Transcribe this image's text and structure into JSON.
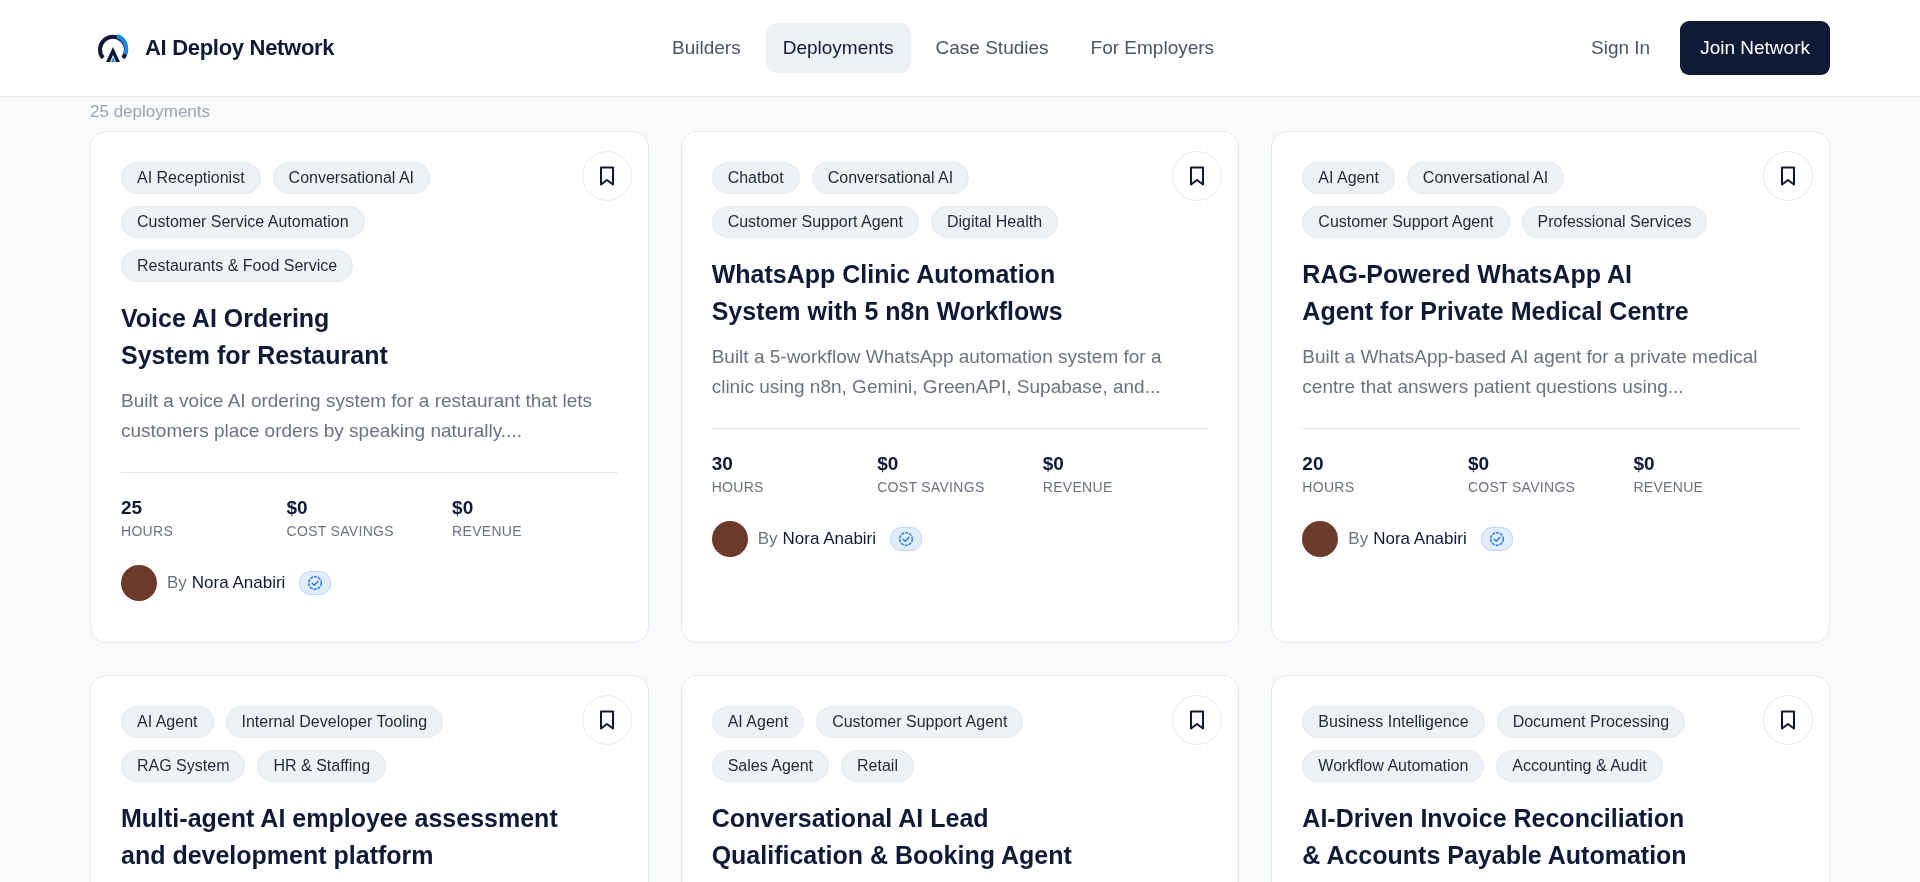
{
  "header": {
    "brand": "AI Deploy Network",
    "nav": [
      {
        "label": "Builders",
        "selected": false
      },
      {
        "label": "Deployments",
        "selected": true
      },
      {
        "label": "Case Studies",
        "selected": false
      },
      {
        "label": "For Employers",
        "selected": false
      }
    ],
    "sign_in": "Sign In",
    "join_button": "Join Network"
  },
  "results_count": "25 deployments",
  "cards": [
    {
      "tags": [
        "AI Receptionist",
        "Conversational AI",
        "Customer Service Automation",
        "Restaurants & Food Service"
      ],
      "title": "Voice AI Ordering System for Restaurant",
      "description": "Built a voice AI ordering system for a restaurant that lets customers place orders by speaking naturally....",
      "stats": [
        {
          "value": "25",
          "label": "HOURS"
        },
        {
          "value": "$0",
          "label": "COST SAVINGS"
        },
        {
          "value": "$0",
          "label": "REVENUE"
        }
      ],
      "author_prefix": "By",
      "author": "Nora Anabiri",
      "verified": true,
      "bookmarked": false
    },
    {
      "tags": [
        "Chatbot",
        "Conversational AI",
        "Customer Support Agent",
        "Digital Health"
      ],
      "title": "WhatsApp Clinic Automation System with 5 n8n Workflows",
      "description": "Built a 5-workflow WhatsApp automation system for a clinic using n8n, Gemini, GreenAPI, Supabase, and...",
      "stats": [
        {
          "value": "30",
          "label": "HOURS"
        },
        {
          "value": "$0",
          "label": "COST SAVINGS"
        },
        {
          "value": "$0",
          "label": "REVENUE"
        }
      ],
      "author_prefix": "By",
      "author": "Nora Anabiri",
      "verified": true,
      "bookmarked": false
    },
    {
      "tags": [
        "AI Agent",
        "Conversational AI",
        "Customer Support Agent",
        "Professional Services"
      ],
      "title": "RAG-Powered WhatsApp AI Agent for Private Medical Centre",
      "description": "Built a WhatsApp-based AI agent for a private medical centre that answers patient questions using...",
      "stats": [
        {
          "value": "20",
          "label": "HOURS"
        },
        {
          "value": "$0",
          "label": "COST SAVINGS"
        },
        {
          "value": "$0",
          "label": "REVENUE"
        }
      ],
      "author_prefix": "By",
      "author": "Nora Anabiri",
      "verified": true,
      "bookmarked": false
    },
    {
      "tags": [
        "AI Agent",
        "Internal Developer Tooling",
        "RAG System",
        "HR & Staffing"
      ],
      "title": "Multi-agent AI employee assessment and development platform",
      "bookmarked": false
    },
    {
      "tags": [
        "AI Agent",
        "Customer Support Agent",
        "Sales Agent",
        "Retail"
      ],
      "title": "Conversational AI Lead Qualification & Booking Agent",
      "bookmarked": false
    },
    {
      "tags": [
        "Business Intelligence",
        "Document Processing",
        "Workflow Automation",
        "Accounting & Audit"
      ],
      "title": "AI-Driven Invoice Reconciliation & Accounts Payable Automation",
      "bookmarked": false
    }
  ]
}
